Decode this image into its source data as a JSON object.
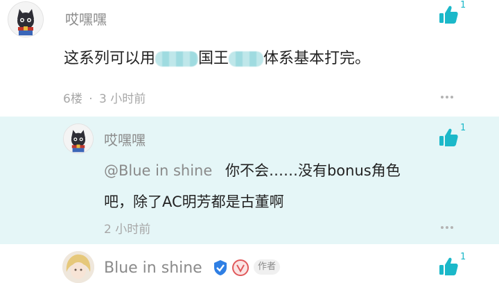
{
  "comment1": {
    "author": "哎嘿嘿",
    "text_a": "这系列可以用",
    "text_b": "国王",
    "text_c": "体系基本打完。",
    "floor": "6楼",
    "separator": "·",
    "time": "3 小时前",
    "like_count": "1"
  },
  "reply": {
    "author": "哎嘿嘿",
    "mention": "@Blue in shine",
    "line1": "你不会……没有bonus角色",
    "line2": "吧，除了AC明芳都是古董啊",
    "time": "2 小时前",
    "like_count": "1"
  },
  "comment2": {
    "author": "Blue in shine",
    "badge_author": "作者",
    "like_count": "1"
  },
  "colors": {
    "accent": "#1bb8c9",
    "reply_bg": "#e5f6f7"
  }
}
